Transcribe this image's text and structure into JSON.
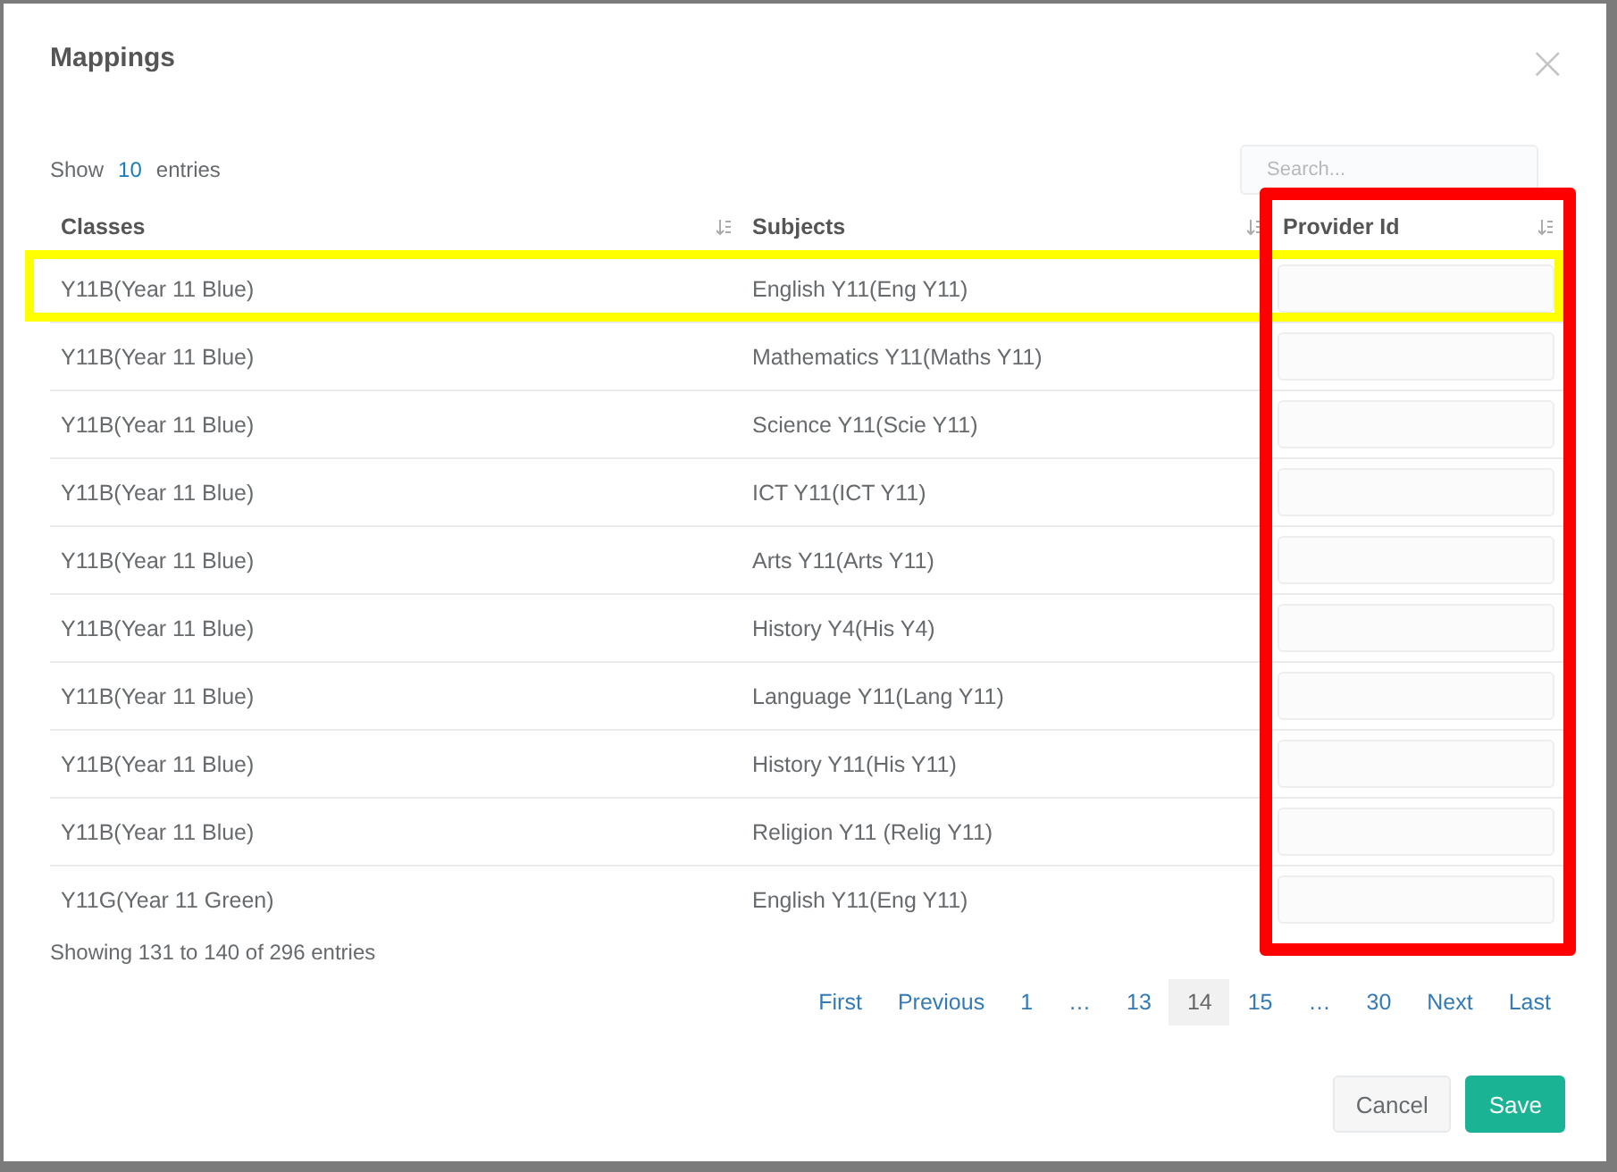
{
  "dialog": {
    "title": "Mappings",
    "close": "×"
  },
  "length": {
    "prefix": "Show",
    "value": "10",
    "suffix": "entries"
  },
  "search": {
    "placeholder": "Search..."
  },
  "table": {
    "columns": [
      "Classes",
      "Subjects",
      "Provider Id"
    ],
    "rows": [
      {
        "class": "Y11B(Year 11 Blue)",
        "subject": "English Y11(Eng Y11)"
      },
      {
        "class": "Y11B(Year 11 Blue)",
        "subject": "Mathematics Y11(Maths Y11)"
      },
      {
        "class": "Y11B(Year 11 Blue)",
        "subject": "Science Y11(Scie Y11)"
      },
      {
        "class": "Y11B(Year 11 Blue)",
        "subject": "ICT Y11(ICT Y11)"
      },
      {
        "class": "Y11B(Year 11 Blue)",
        "subject": "Arts Y11(Arts Y11)"
      },
      {
        "class": "Y11B(Year 11 Blue)",
        "subject": "History Y4(His Y4)"
      },
      {
        "class": "Y11B(Year 11 Blue)",
        "subject": "Language Y11(Lang Y11)"
      },
      {
        "class": "Y11B(Year 11 Blue)",
        "subject": "History Y11(His Y11)"
      },
      {
        "class": "Y11B(Year 11 Blue)",
        "subject": "Religion Y11 (Relig Y11)"
      },
      {
        "class": "Y11G(Year 11 Green)",
        "subject": "English Y11(Eng Y11)"
      }
    ]
  },
  "info": "Showing 131 to 140 of 296 entries",
  "pagination": [
    {
      "label": "First",
      "selected": false
    },
    {
      "label": "Previous",
      "selected": false
    },
    {
      "label": "1",
      "selected": false
    },
    {
      "label": "…",
      "selected": false
    },
    {
      "label": "13",
      "selected": false
    },
    {
      "label": "14",
      "selected": true
    },
    {
      "label": "15",
      "selected": false
    },
    {
      "label": "…",
      "selected": false
    },
    {
      "label": "30",
      "selected": false
    },
    {
      "label": "Next",
      "selected": false
    },
    {
      "label": "Last",
      "selected": false
    }
  ],
  "buttons": [
    {
      "label": "Cancel",
      "kind": "secondary"
    },
    {
      "label": "Save",
      "kind": "primary"
    }
  ]
}
